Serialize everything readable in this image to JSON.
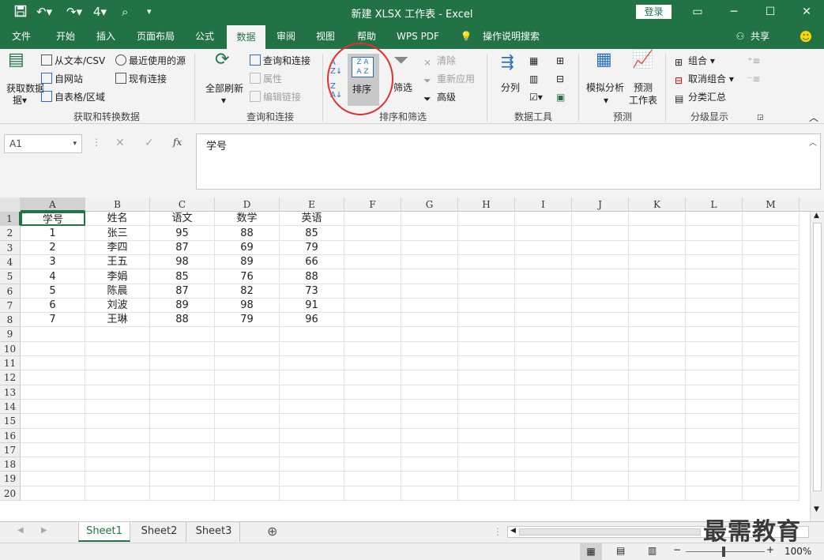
{
  "titlebar": {
    "title": "新建 XLSX 工作表 - Excel",
    "login": "登录"
  },
  "tabs": [
    "文件",
    "开始",
    "插入",
    "页面布局",
    "公式",
    "数据",
    "审阅",
    "视图",
    "帮助",
    "WPS PDF",
    "操作说明搜索"
  ],
  "share": "共享",
  "ribbon": {
    "get_data": "获取数据",
    "from_text": "从文本/CSV",
    "recent_sources": "最近使用的源",
    "from_web": "自网站",
    "existing_conn": "现有连接",
    "from_table": "自表格/区域",
    "refresh_all": "全部刷新",
    "queries_conn": "查询和连接",
    "properties": "属性",
    "edit_links": "编辑链接",
    "sort": "排序",
    "filter": "筛选",
    "clear": "清除",
    "reapply": "重新应用",
    "advanced": "高级",
    "text_to_cols": "分列",
    "what_if": "模拟分析",
    "forecast_sheet": "预测\n工作表",
    "group": "组合",
    "ungroup": "取消组合",
    "subtotal": "分类汇总",
    "group_labels": [
      "获取和转换数据",
      "查询和连接",
      "排序和筛选",
      "数据工具",
      "预测",
      "分级显示"
    ]
  },
  "formula_bar": {
    "name_box": "A1",
    "fx": "fx",
    "content": "学号"
  },
  "columns": [
    "A",
    "B",
    "C",
    "D",
    "E",
    "F",
    "G",
    "H",
    "I",
    "J",
    "K",
    "L",
    "M"
  ],
  "rows": [
    [
      "学号",
      "姓名",
      "语文",
      "数学",
      "英语"
    ],
    [
      "1",
      "张三",
      "95",
      "88",
      "85"
    ],
    [
      "2",
      "李四",
      "87",
      "69",
      "79"
    ],
    [
      "3",
      "王五",
      "98",
      "89",
      "66"
    ],
    [
      "4",
      "李娟",
      "85",
      "76",
      "88"
    ],
    [
      "5",
      "陈晨",
      "87",
      "82",
      "73"
    ],
    [
      "6",
      "刘波",
      "89",
      "98",
      "91"
    ],
    [
      "7",
      "王琳",
      "88",
      "79",
      "96"
    ]
  ],
  "row_numbers": [
    "1",
    "2",
    "3",
    "4",
    "5",
    "6",
    "7",
    "8",
    "9",
    "10",
    "11",
    "12",
    "13",
    "14",
    "15",
    "16",
    "17",
    "18",
    "19",
    "20"
  ],
  "sheets": [
    "Sheet1",
    "Sheet2",
    "Sheet3"
  ],
  "status": {
    "zoom": "100%"
  },
  "watermark": "最需教育",
  "colors": {
    "accent": "#217346",
    "highlight_circle": "#e03030"
  }
}
